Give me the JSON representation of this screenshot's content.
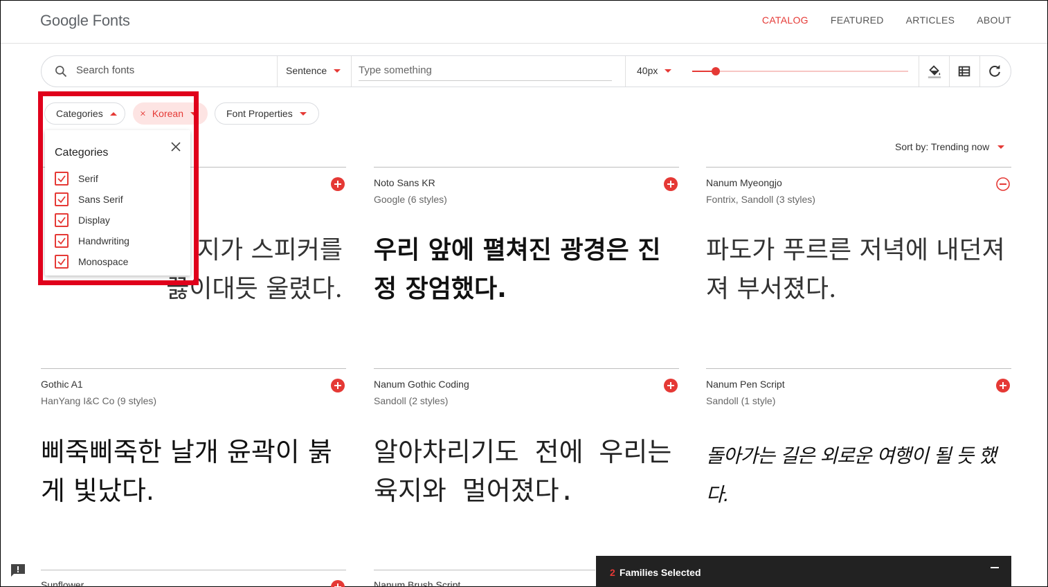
{
  "header": {
    "logo": "Google Fonts",
    "nav": [
      "CATALOG",
      "FEATURED",
      "ARTICLES",
      "ABOUT"
    ],
    "active_nav": "CATALOG"
  },
  "toolbar": {
    "search_placeholder": "Search fonts",
    "preview_mode": "Sentence",
    "type_placeholder": "Type something",
    "font_size": "40px",
    "icons": [
      "search-icon",
      "paint-bucket-icon",
      "list-view-icon",
      "refresh-icon"
    ]
  },
  "filters": {
    "categories_chip": "Categories",
    "language_chip": "Korean",
    "properties_chip": "Font Properties"
  },
  "categories_dropdown": {
    "title": "Categories",
    "items": [
      {
        "label": "Serif",
        "checked": true
      },
      {
        "label": "Sans Serif",
        "checked": true
      },
      {
        "label": "Display",
        "checked": true
      },
      {
        "label": "Handwriting",
        "checked": true
      },
      {
        "label": "Monospace",
        "checked": true
      }
    ]
  },
  "sort": "Sort by: Trending now",
  "fonts": [
    {
      "name": "",
      "meta": "",
      "sample": "지가 스피커를\n끓이대듯 울렸다.",
      "selected": false
    },
    {
      "name": "Noto Sans KR",
      "meta": "Google (6 styles)",
      "sample": "우리 앞에 펼쳐진 광경은 진정 장엄했다.",
      "selected": false
    },
    {
      "name": "Nanum Myeongjo",
      "meta": "Fontrix, Sandoll (3 styles)",
      "sample": "파도가 푸르른 저녁에 내던져져 부서졌다.",
      "selected": true
    },
    {
      "name": "Gothic A1",
      "meta": "HanYang I&C Co (9 styles)",
      "sample": "삐죽삐죽한 날개 윤곽이 붉게 빛났다.",
      "selected": false
    },
    {
      "name": "Nanum Gothic Coding",
      "meta": "Sandoll (2 styles)",
      "sample": "알아차리기도 전에 우리는 육지와 멀어졌다.",
      "selected": false
    },
    {
      "name": "Nanum Pen Script",
      "meta": "Sandoll (1 style)",
      "sample": "돌아가는 길은 외로운 여행이 될 듯 했다.",
      "selected": false
    },
    {
      "name": "Sunflower",
      "meta": "",
      "sample": "",
      "selected": false
    },
    {
      "name": "Nanum Brush Script",
      "meta": "",
      "sample": "",
      "selected": false
    }
  ],
  "selection_bar": {
    "count": "2",
    "label": "Families Selected"
  },
  "colors": {
    "accent": "#e53935",
    "highlight_box": "#e0001b"
  }
}
